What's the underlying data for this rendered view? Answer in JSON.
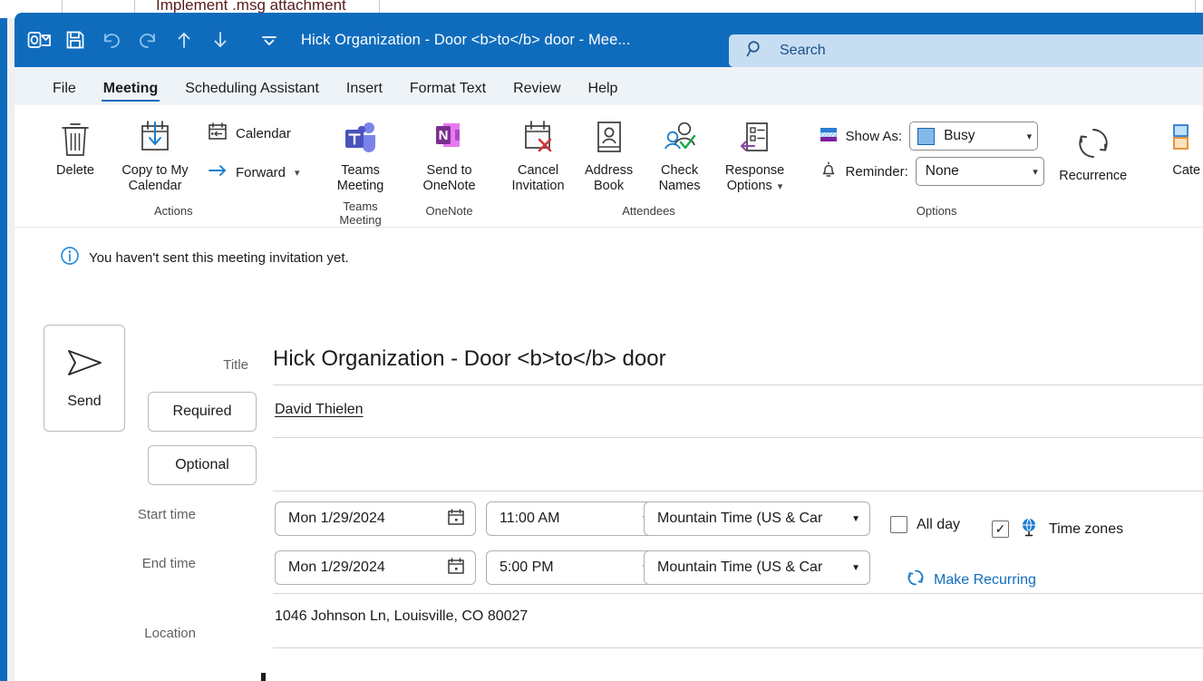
{
  "background": {
    "peek_text": "Implement .msg attachment"
  },
  "titlebar": {
    "title": "Hick Organization - Door <b>to</b> door  -  Mee...",
    "quick_access": [
      {
        "name": "outlook-logo-icon",
        "label": "Outlook"
      },
      {
        "name": "save-icon",
        "label": "Save"
      },
      {
        "name": "undo-icon",
        "label": "Undo"
      },
      {
        "name": "redo-icon",
        "label": "Redo"
      },
      {
        "name": "previous-item-icon",
        "label": "Previous Item"
      },
      {
        "name": "next-item-icon",
        "label": "Next Item"
      },
      {
        "name": "customize-quick-access-toolbar-icon",
        "label": "Customize Quick Access Toolbar"
      }
    ],
    "search": {
      "placeholder": "Search",
      "icon": "search-icon"
    },
    "accent_color": "#0f6cbd"
  },
  "tabs": [
    {
      "label": "File",
      "active": false
    },
    {
      "label": "Meeting",
      "active": true
    },
    {
      "label": "Scheduling Assistant",
      "active": false
    },
    {
      "label": "Insert",
      "active": false
    },
    {
      "label": "Format Text",
      "active": false
    },
    {
      "label": "Review",
      "active": false
    },
    {
      "label": "Help",
      "active": false
    }
  ],
  "ribbon": {
    "groups": [
      {
        "label": "Actions",
        "big_buttons": [
          {
            "label": "Delete",
            "icon": "trash-icon"
          },
          {
            "label": "Copy to My Calendar",
            "icon": "calendar-download-icon"
          }
        ],
        "small_buttons": [
          {
            "label": "Calendar",
            "icon": "calendar-back-icon",
            "has_chevron": false
          },
          {
            "label": "Forward",
            "icon": "forward-arrow-icon",
            "has_chevron": true
          }
        ]
      },
      {
        "label": "Teams Meeting",
        "big_buttons": [
          {
            "label": "Teams Meeting",
            "icon": "teams-icon"
          }
        ],
        "small_buttons": []
      },
      {
        "label": "OneNote",
        "big_buttons": [
          {
            "label": "Send to OneNote",
            "icon": "onenote-icon"
          }
        ],
        "small_buttons": []
      },
      {
        "label": "Attendees",
        "big_buttons": [
          {
            "label": "Cancel Invitation",
            "icon": "calendar-cancel-icon"
          },
          {
            "label": "Address Book",
            "icon": "address-book-icon"
          },
          {
            "label": "Check Names",
            "icon": "check-names-icon"
          },
          {
            "label": "Response Options",
            "icon": "response-options-icon",
            "has_chevron": true
          }
        ],
        "small_buttons": []
      }
    ],
    "options": {
      "label": "Options",
      "show_as": {
        "label": "Show As:",
        "icon": "show-as-icon",
        "value": "Busy",
        "swatch_color": "#83b9e8"
      },
      "reminder": {
        "label": "Reminder:",
        "icon": "bell-icon",
        "value": "None"
      },
      "recurrence": {
        "label": "Recurrence",
        "icon": "recurrence-icon"
      }
    },
    "tags": {
      "categorize": {
        "label": "Cate",
        "icon": "categorize-icon"
      }
    }
  },
  "form": {
    "info_bar": {
      "icon": "info-icon",
      "text": "You haven't sent this meeting invitation yet."
    },
    "send_button": {
      "label": "Send",
      "icon": "send-arrow-icon"
    },
    "title_field": {
      "label": "Title",
      "value": "Hick Organization - Door <b>to</b> door"
    },
    "required_button": {
      "label": "Required"
    },
    "optional_button": {
      "label": "Optional"
    },
    "attendees": {
      "required_value": "David Thielen",
      "optional_value": ""
    },
    "start_time": {
      "label": "Start time",
      "date": "Mon 1/29/2024",
      "time": "11:00 AM",
      "timezone": "Mountain Time (US & Car",
      "date_icon": "calendar-picker-icon"
    },
    "end_time": {
      "label": "End time",
      "date": "Mon 1/29/2024",
      "time": "5:00 PM",
      "timezone": "Mountain Time (US & Car",
      "date_icon": "calendar-picker-icon"
    },
    "all_day": {
      "label": "All day",
      "checked": false
    },
    "time_zones": {
      "label": "Time zones",
      "checked": true,
      "icon": "globe-icon"
    },
    "make_recurring": {
      "label": "Make Recurring",
      "icon": "recurring-icon"
    },
    "location": {
      "label": "Location",
      "value": "1046 Johnson Ln, Louisville, CO 80027"
    }
  }
}
